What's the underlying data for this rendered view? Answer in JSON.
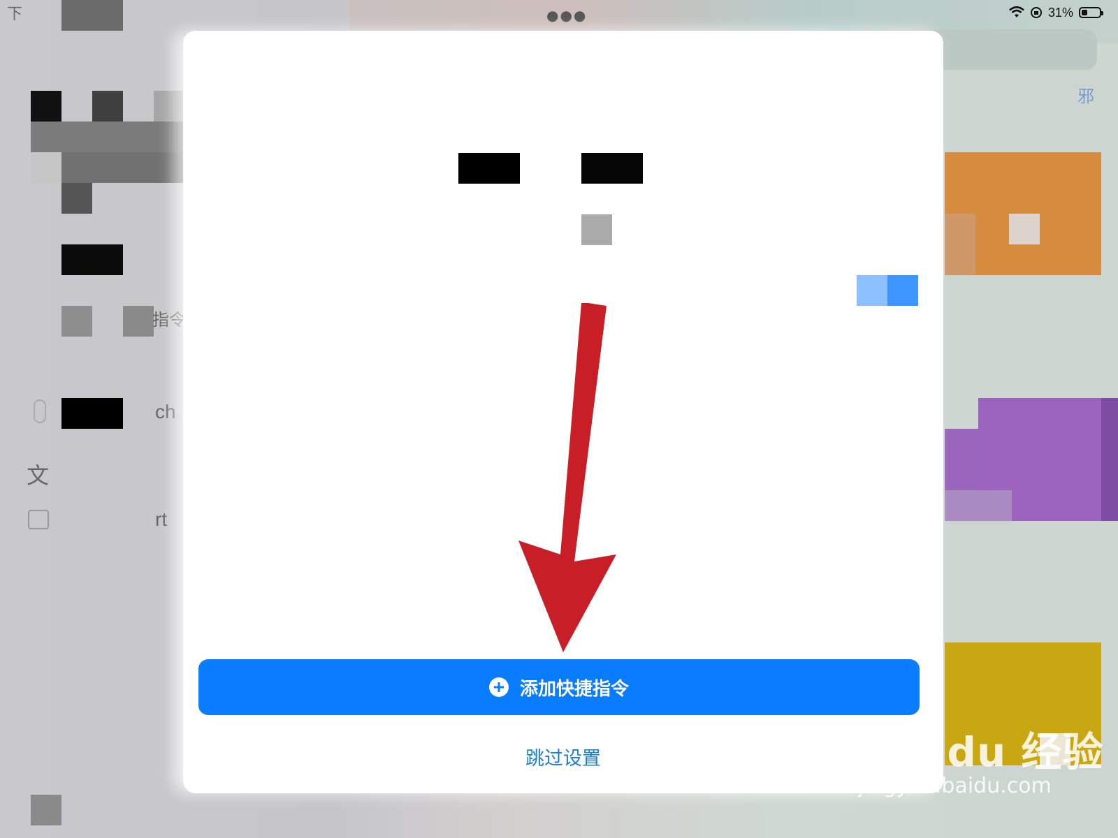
{
  "status_bar": {
    "battery": "31%"
  },
  "sidebar": {
    "items": [
      {
        "label": "下"
      },
      {
        "label": "指令"
      },
      {
        "label": "ch"
      },
      {
        "label": "文"
      },
      {
        "label": "rt"
      }
    ]
  },
  "top_right_text": "邪",
  "dialog": {
    "primary_button": "添加快捷指令",
    "secondary_link": "跳过设置"
  },
  "watermark": {
    "brand": "Bai du 经验",
    "url": "jingyan.baidu.com"
  },
  "colors": {
    "primary_blue": "#0a7cff",
    "link_blue": "#1a7fd8",
    "arrow_red": "#c81e28",
    "tile_orange": "#d58c3f",
    "tile_purple": "#9b63bd",
    "tile_yellow": "#c9a712"
  }
}
